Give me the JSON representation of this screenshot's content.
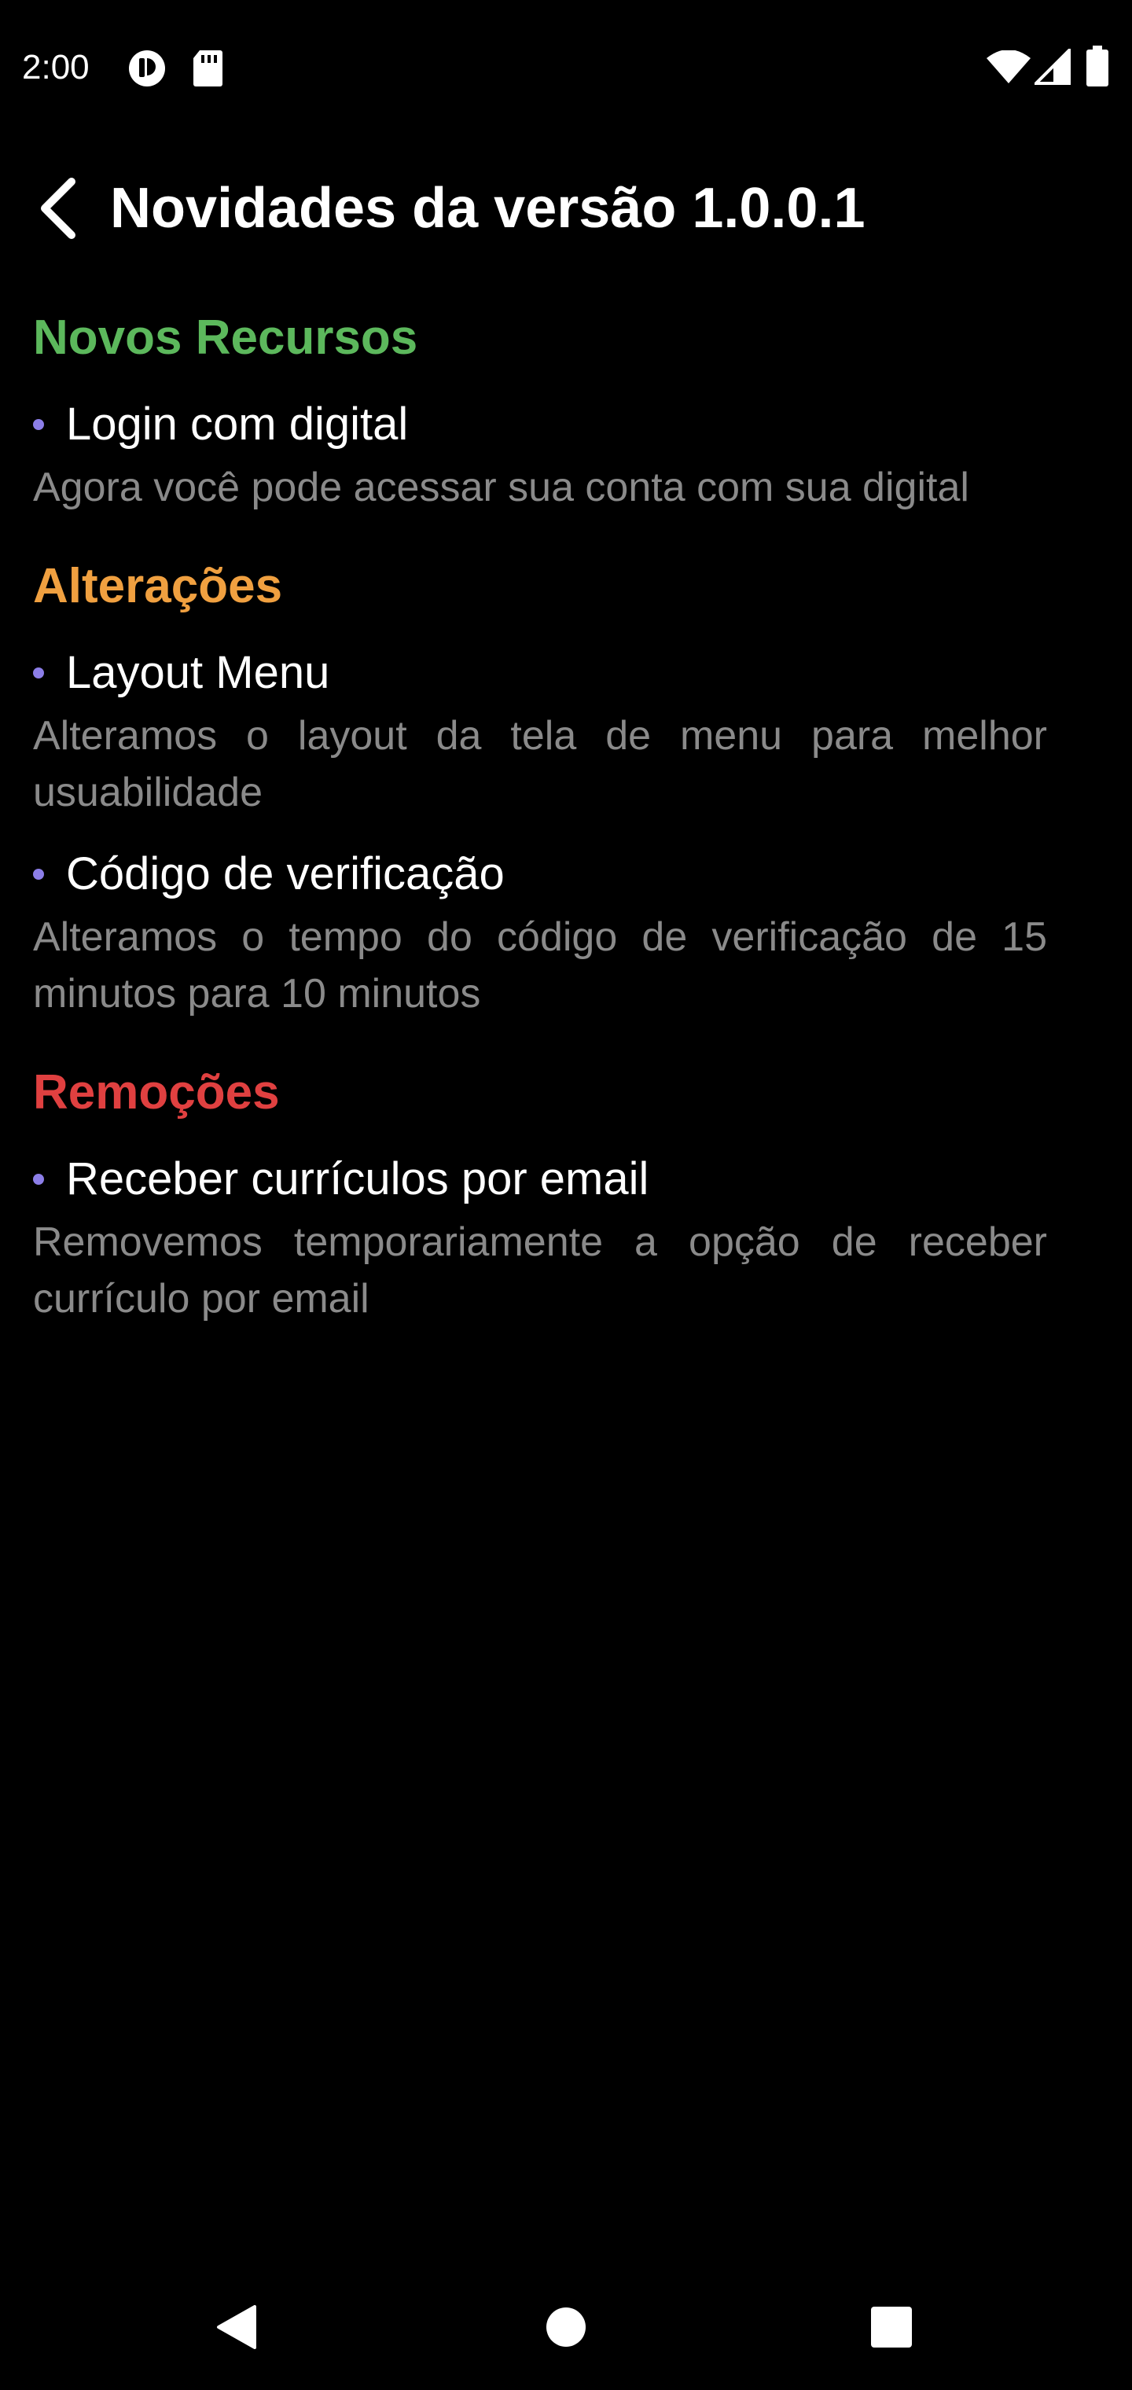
{
  "status_bar": {
    "time": "2:00",
    "icons": [
      "notification-circle-icon",
      "sd-card-icon",
      "wifi-icon",
      "signal-icon",
      "battery-icon"
    ]
  },
  "app_bar": {
    "back_icon": "chevron-left-icon",
    "title": "Novidades da versão 1.0.0.1"
  },
  "colors": {
    "background": "#000000",
    "new_features": "#5cb85c",
    "changes": "#f0a040",
    "removals": "#e04040",
    "bullet": "#8c7ee8",
    "description": "#8a8a8a"
  },
  "sections": [
    {
      "title": "Novos Recursos",
      "items": [
        {
          "title": "Login com digital",
          "description": "Agora você pode acessar sua conta com sua digital"
        }
      ]
    },
    {
      "title": "Alterações",
      "items": [
        {
          "title": "Layout Menu",
          "description": "Alteramos o layout da tela de menu para melhor usuabilidade"
        },
        {
          "title": "Código de verificação",
          "description": "Alteramos o tempo do código de verificação de 15 minutos para 10 minutos"
        }
      ]
    },
    {
      "title": "Remoções",
      "items": [
        {
          "title": "Receber currículos por email",
          "description": "Removemos temporariamente a opção de receber currículo por email"
        }
      ]
    }
  ],
  "nav_bar": {
    "icons": [
      "back-triangle-icon",
      "home-circle-icon",
      "recents-square-icon"
    ]
  }
}
